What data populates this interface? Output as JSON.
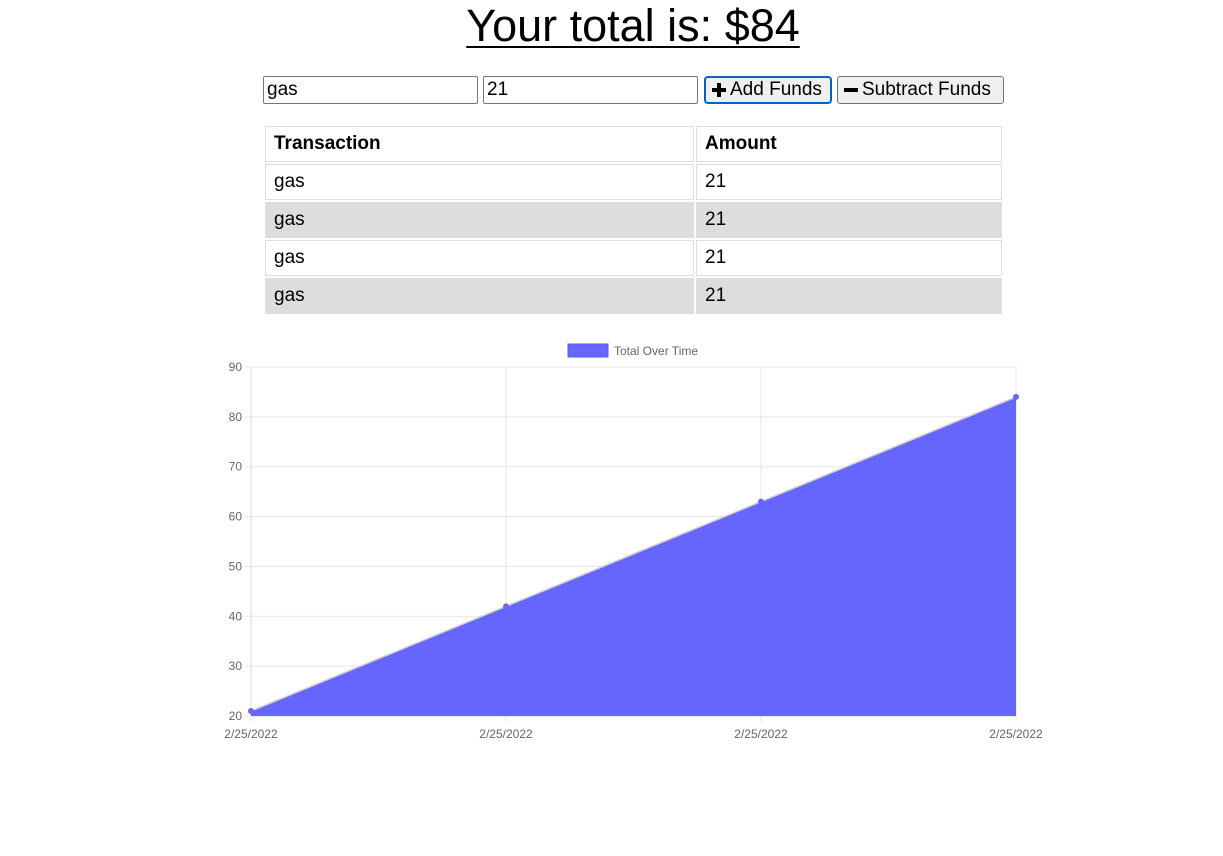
{
  "header": {
    "title": "Your total is: $84"
  },
  "form": {
    "name_value": "gas",
    "amount_value": "21",
    "add_label": "Add Funds",
    "subtract_label": "Subtract Funds"
  },
  "table": {
    "headers": [
      "Transaction",
      "Amount"
    ],
    "rows": [
      [
        "gas",
        "21"
      ],
      [
        "gas",
        "21"
      ],
      [
        "gas",
        "21"
      ],
      [
        "gas",
        "21"
      ]
    ]
  },
  "chart_data": {
    "type": "area",
    "x": [
      "2/25/2022",
      "2/25/2022",
      "2/25/2022",
      "2/25/2022"
    ],
    "series": [
      {
        "name": "Total Over Time",
        "values": [
          21,
          42,
          63,
          84
        ],
        "color": "#6666ff"
      }
    ],
    "ylim": [
      20,
      90
    ],
    "yticks": [
      20,
      30,
      40,
      50,
      60,
      70,
      80,
      90
    ],
    "grid": true,
    "legend": "top-center"
  }
}
